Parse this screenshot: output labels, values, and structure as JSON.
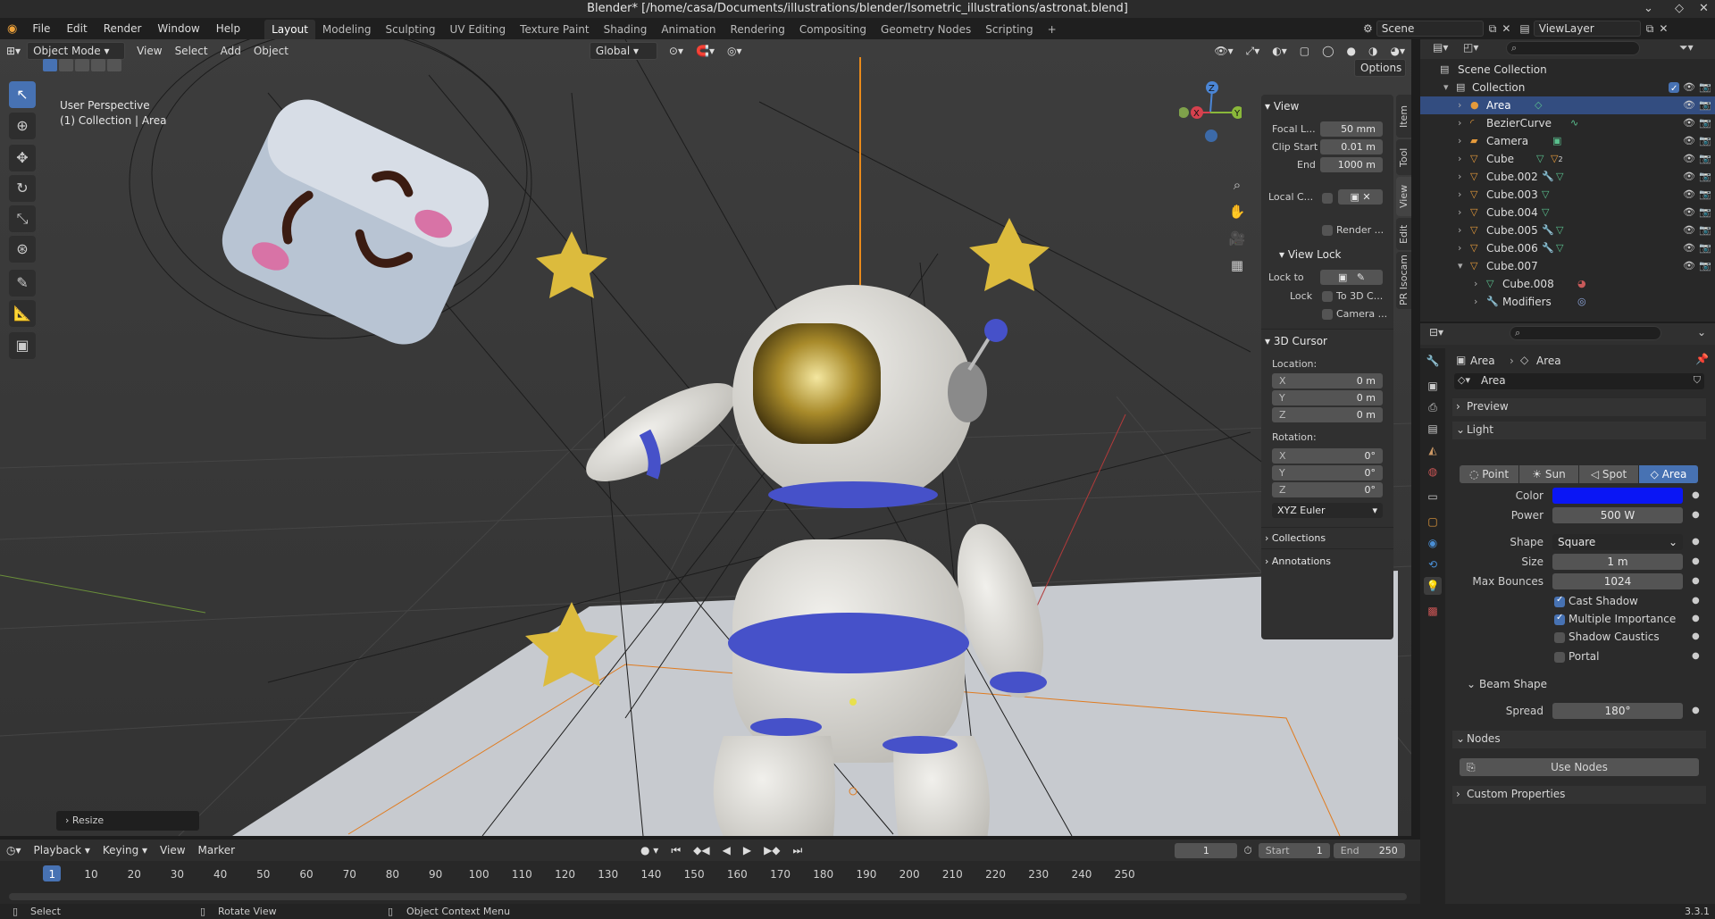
{
  "window": {
    "title": "Blender* [/home/casa/Documents/illustrations/blender/Isometric_illustrations/astronat.blend]"
  },
  "menus": [
    "File",
    "Edit",
    "Render",
    "Window",
    "Help"
  ],
  "workspaces": [
    "Layout",
    "Modeling",
    "Sculpting",
    "UV Editing",
    "Texture Paint",
    "Shading",
    "Animation",
    "Rendering",
    "Compositing",
    "Geometry Nodes",
    "Scripting"
  ],
  "active_workspace": "Layout",
  "scene": {
    "name": "Scene",
    "view_layer": "ViewLayer"
  },
  "viewport": {
    "mode": "Object Mode",
    "menus": [
      "View",
      "Select",
      "Add",
      "Object"
    ],
    "transform_orientation": "Global",
    "options_label": "Options",
    "overlay_title": "User Perspective",
    "overlay_sub": "(1) Collection | Area",
    "last_op": "Resize",
    "axes": {
      "x": "X",
      "y": "Y",
      "z": "Z"
    }
  },
  "npanel": {
    "tabs": [
      "Item",
      "Tool",
      "View",
      "Edit",
      "PR Isocam"
    ],
    "active_tab": "View",
    "view": {
      "title": "View",
      "focal_label": "Focal L...",
      "focal_value": "50 mm",
      "clip_start_label": "Clip Start",
      "clip_start_value": "0.01 m",
      "end_label": "End",
      "end_value": "1000 m",
      "local_camera_label": "Local C...",
      "render_region_label": "Render ...",
      "view_lock_title": "View Lock",
      "lock_to_label": "Lock to",
      "lock_label": "Lock",
      "to_3d_cursor": "To 3D C...",
      "camera_to_view": "Camera ..."
    },
    "cursor": {
      "title": "3D Cursor",
      "location_label": "Location:",
      "loc": [
        {
          "k": "X",
          "v": "0 m"
        },
        {
          "k": "Y",
          "v": "0 m"
        },
        {
          "k": "Z",
          "v": "0 m"
        }
      ],
      "rotation_label": "Rotation:",
      "rot": [
        {
          "k": "X",
          "v": "0°"
        },
        {
          "k": "Y",
          "v": "0°"
        },
        {
          "k": "Z",
          "v": "0°"
        }
      ],
      "rotation_mode": "XYZ Euler"
    },
    "collections": "Collections",
    "annotations": "Annotations"
  },
  "outliner": {
    "search_placeholder": "",
    "rows": [
      {
        "label": "Scene Collection",
        "indent": 0
      },
      {
        "label": "Collection",
        "indent": 1
      },
      {
        "label": "Area",
        "indent": 2,
        "selected": true
      },
      {
        "label": "BezierCurve",
        "indent": 2
      },
      {
        "label": "Camera",
        "indent": 2
      },
      {
        "label": "Cube",
        "indent": 2,
        "badge": "2"
      },
      {
        "label": "Cube.002",
        "indent": 2
      },
      {
        "label": "Cube.003",
        "indent": 2
      },
      {
        "label": "Cube.004",
        "indent": 2
      },
      {
        "label": "Cube.005",
        "indent": 2
      },
      {
        "label": "Cube.006",
        "indent": 2
      },
      {
        "label": "Cube.007",
        "indent": 2
      },
      {
        "label": "Cube.008",
        "indent": 3
      },
      {
        "label": "Modifiers",
        "indent": 3
      }
    ]
  },
  "properties": {
    "breadcrumb": [
      "Area",
      "Area"
    ],
    "datablock": "Area",
    "preview": "Preview",
    "light": "Light",
    "light_types": [
      "Point",
      "Sun",
      "Spot",
      "Area"
    ],
    "active_type": "Area",
    "color_label": "Color",
    "color_value": "#0a16f5",
    "power_label": "Power",
    "power_value": "500 W",
    "shape_label": "Shape",
    "shape_value": "Square",
    "size_label": "Size",
    "size_value": "1 m",
    "bounces_label": "Max Bounces",
    "bounces_value": "1024",
    "cast_shadow": "Cast Shadow",
    "multiple_importance": "Multiple Importance",
    "shadow_caustics": "Shadow Caustics",
    "portal": "Portal",
    "beam_shape": "Beam Shape",
    "spread_label": "Spread",
    "spread_value": "180°",
    "nodes": "Nodes",
    "use_nodes": "Use Nodes",
    "custom_properties": "Custom Properties"
  },
  "timeline": {
    "menus": [
      "Playback",
      "Keying",
      "View",
      "Marker"
    ],
    "current_frame": "1",
    "start_label": "Start",
    "start_value": "1",
    "end_label": "End",
    "end_value": "250",
    "ticks": [
      "1",
      "10",
      "20",
      "30",
      "40",
      "50",
      "60",
      "70",
      "80",
      "90",
      "100",
      "110",
      "120",
      "130",
      "140",
      "150",
      "160",
      "170",
      "180",
      "190",
      "200",
      "210",
      "220",
      "230",
      "240",
      "250"
    ]
  },
  "status": {
    "select": "Select",
    "rotate": "Rotate View",
    "context": "Object Context Menu",
    "version": "3.3.1"
  }
}
